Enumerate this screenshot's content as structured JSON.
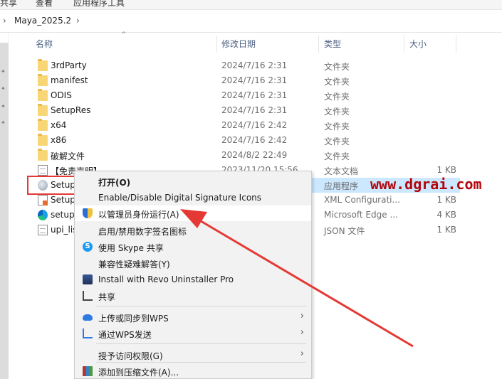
{
  "ribbon": {
    "tabs": [
      "共享",
      "查看",
      "应用程序工具"
    ]
  },
  "address": {
    "path": "Maya_2025.2"
  },
  "columns": {
    "name": "名称",
    "date": "修改日期",
    "type": "类型",
    "size": "大小"
  },
  "rows": [
    {
      "name": "3rdParty",
      "date": "2024/7/16 2:31",
      "type": "文件夹",
      "size": "",
      "icon": "folder-icon"
    },
    {
      "name": "manifest",
      "date": "2024/7/16 2:31",
      "type": "文件夹",
      "size": "",
      "icon": "folder-icon"
    },
    {
      "name": "ODIS",
      "date": "2024/7/16 2:31",
      "type": "文件夹",
      "size": "",
      "icon": "folder-icon"
    },
    {
      "name": "SetupRes",
      "date": "2024/7/16 2:31",
      "type": "文件夹",
      "size": "",
      "icon": "folder-icon"
    },
    {
      "name": "x64",
      "date": "2024/7/16 2:42",
      "type": "文件夹",
      "size": "",
      "icon": "folder-icon"
    },
    {
      "name": "x86",
      "date": "2024/7/16 2:42",
      "type": "文件夹",
      "size": "",
      "icon": "folder-icon"
    },
    {
      "name": "破解文件",
      "date": "2024/8/2 22:49",
      "type": "文件夹",
      "size": "",
      "icon": "folder-icon"
    },
    {
      "name": "【免责声明】",
      "date": "2023/11/20 15:56",
      "type": "文本文档",
      "size": "1 KB",
      "icon": "text-document-icon"
    },
    {
      "name": "Setup",
      "date": "",
      "type": "应用程序",
      "size": "",
      "icon": "setup-app-icon"
    },
    {
      "name": "Setup",
      "date": "",
      "type": "XML Configurati...",
      "size": "1 KB",
      "icon": "xml-file-icon"
    },
    {
      "name": "setup",
      "date": "",
      "type": "Microsoft Edge ...",
      "size": "4 KB",
      "icon": "edge-html-icon"
    },
    {
      "name": "upi_lis",
      "date": "",
      "type": "JSON 文件",
      "size": "1 KB",
      "icon": "json-file-icon"
    }
  ],
  "context_menu": {
    "items": [
      {
        "label": "打开(O)",
        "icon": "",
        "bold": true
      },
      {
        "label": "Enable/Disable Digital Signature Icons",
        "icon": ""
      },
      {
        "label": "以管理员身份运行(A)",
        "icon": "uac-shield-icon"
      },
      {
        "label": "启用/禁用数字签名图标",
        "icon": ""
      },
      {
        "label": "使用 Skype 共享",
        "icon": "skype-icon"
      },
      {
        "label": "兼容性疑难解答(Y)",
        "icon": ""
      },
      {
        "label": "Install with Revo Uninstaller Pro",
        "icon": "revo-uninstaller-icon"
      },
      {
        "label": "共享",
        "icon": "share-icon"
      },
      {
        "label": "上传或同步到WPS",
        "icon": "wps-cloud-icon",
        "submenu": true
      },
      {
        "label": "通过WPS发送",
        "icon": "wps-send-icon",
        "submenu": true
      },
      {
        "label": "授予访问权限(G)",
        "icon": "",
        "submenu": true
      },
      {
        "label": "添加到压缩文件(A)...",
        "icon": "winrar-icon"
      }
    ]
  },
  "watermark": "www.dgrai.com",
  "colors": {
    "highlight_box": "#e53935",
    "arrow": "#e53935",
    "selection": "#cce8ff",
    "watermark": "#b3060c"
  }
}
